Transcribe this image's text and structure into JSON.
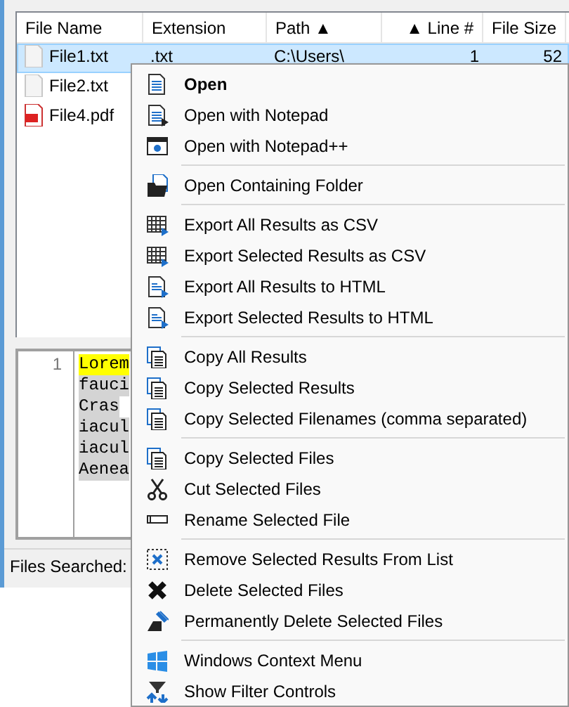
{
  "table": {
    "columns": [
      {
        "label": "File Name"
      },
      {
        "label": "Extension"
      },
      {
        "label": "Path ▲"
      },
      {
        "label": "▲ Line #"
      },
      {
        "label": "File Size"
      }
    ],
    "rows": [
      {
        "selected": true,
        "kind": "text",
        "cells": [
          "File1.txt",
          ".txt",
          "C:\\Users\\",
          "1",
          "52"
        ]
      },
      {
        "selected": false,
        "kind": "text",
        "cells": [
          "File2.txt"
        ]
      },
      {
        "selected": false,
        "kind": "pdf",
        "cells": [
          "File4.pdf"
        ]
      }
    ]
  },
  "preview": {
    "line_numbers": [
      "1"
    ],
    "lines": [
      {
        "text": "Lorem",
        "highlighted": true
      },
      {
        "text": "fauci",
        "highlighted": false
      },
      {
        "text": "Cras",
        "highlighted": false
      },
      {
        "text": "iacul",
        "highlighted": false
      },
      {
        "text": "iacul",
        "highlighted": false
      },
      {
        "text": "Aenea",
        "highlighted": false
      }
    ]
  },
  "status_bar": {
    "text": "Files Searched:"
  },
  "context_menu": {
    "groups": [
      {
        "items": [
          {
            "label": "Open",
            "default": true
          },
          {
            "label": "Open with Notepad",
            "default": false
          },
          {
            "label": "Open with Notepad++",
            "default": false
          }
        ]
      },
      {
        "items": [
          {
            "label": "Open Containing Folder",
            "default": false
          }
        ]
      },
      {
        "items": [
          {
            "label": "Export All Results as CSV",
            "default": false
          },
          {
            "label": "Export Selected Results as CSV",
            "default": false
          },
          {
            "label": "Export All Results to HTML",
            "default": false
          },
          {
            "label": "Export Selected Results to HTML",
            "default": false
          }
        ]
      },
      {
        "items": [
          {
            "label": "Copy All Results",
            "default": false
          },
          {
            "label": "Copy Selected Results",
            "default": false
          },
          {
            "label": "Copy Selected Filenames (comma separated)",
            "default": false
          }
        ]
      },
      {
        "items": [
          {
            "label": "Copy Selected Files",
            "default": false
          },
          {
            "label": "Cut Selected Files",
            "default": false
          },
          {
            "label": "Rename Selected File",
            "default": false
          }
        ]
      },
      {
        "items": [
          {
            "label": "Remove Selected Results From List",
            "default": false
          },
          {
            "label": "Delete Selected Files",
            "default": false
          },
          {
            "label": "Permanently Delete Selected Files",
            "default": false
          }
        ]
      },
      {
        "items": [
          {
            "label": "Windows Context Menu",
            "default": false
          },
          {
            "label": "Show Filter Controls",
            "default": false
          }
        ]
      }
    ]
  }
}
